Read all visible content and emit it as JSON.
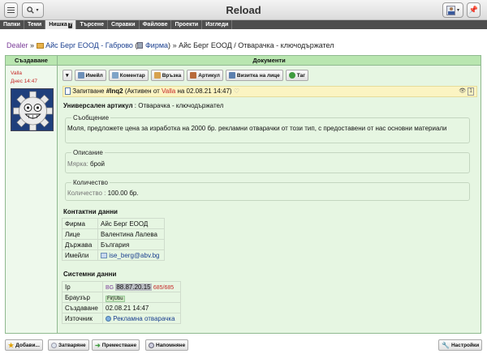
{
  "app": {
    "title": "Reload"
  },
  "nav": [
    {
      "label": "Папки"
    },
    {
      "label": "Теми"
    },
    {
      "label": "Нишка",
      "badge": "?"
    },
    {
      "label": "Търсене"
    },
    {
      "label": "Справки"
    },
    {
      "label": "Файлове"
    },
    {
      "label": "Проекти"
    },
    {
      "label": "Изгледи"
    }
  ],
  "breadcrumb": {
    "root": "Dealer",
    "sep": "»",
    "company": "Айс Берг ЕООД - Габрово",
    "open_paren": "(",
    "type": "Фирма",
    "close_paren": ")",
    "current": "Айс Берг ЕООД / Отварачка - ключодържател"
  },
  "columns": {
    "left": "Създаване",
    "right": "Документи"
  },
  "author": {
    "name": "Valla",
    "when": "Днес 14:47"
  },
  "toolbar": {
    "buttons": [
      {
        "label": "Имейл",
        "icon": "email-icon",
        "color": "#6d8fb8"
      },
      {
        "label": "Коментар",
        "icon": "comment-icon",
        "color": "#7ea3c7"
      },
      {
        "label": "Връзка",
        "icon": "link-icon",
        "color": "#d7a24f"
      },
      {
        "label": "Артикул",
        "icon": "article-icon",
        "color": "#b86a3a"
      },
      {
        "label": "Визитка на лице",
        "icon": "vcard-icon",
        "color": "#5b7fae"
      },
      {
        "label": "Таг",
        "icon": "tag-icon",
        "color": "#3f9b3f"
      }
    ]
  },
  "request": {
    "label": "Запитване",
    "id": "#Inq2",
    "status_open": "(Активен от",
    "user": "Valla",
    "status_close": "на 02.08.21 14:47)",
    "views": "1"
  },
  "article": {
    "label": "Универсален артикул",
    "value": ": Отварачка - ключодържател"
  },
  "message": {
    "legend": "Съобщение",
    "text": "Моля, предложете цена за изработка на 2000 бр. рекламни отварачки от този тип, с предоставени от нас основни материали"
  },
  "description": {
    "legend": "Описание",
    "unit_label": "Мярка:",
    "unit_value": "брой"
  },
  "quantity": {
    "legend": "Количество",
    "label": "Количество :",
    "value": "100.00 бр."
  },
  "contact": {
    "heading": "Контактни данни",
    "rows": [
      {
        "key": "Фирма",
        "value": "Айс Берг ЕООД"
      },
      {
        "key": "Лице",
        "value": "Валентина Лалева"
      },
      {
        "key": "Държава",
        "value": "България"
      },
      {
        "key": "Имейли",
        "value": "ise_berg@abv.bg"
      }
    ]
  },
  "system": {
    "heading": "Системни данни",
    "ip_label": "Ip",
    "ip_country": "BG",
    "ip": "88.87.20.15",
    "ip_count": "685/685",
    "browser_label": "Браузър",
    "browser": "Fir|Ubu",
    "created_label": "Създаване",
    "created": "02.08.21 14:47",
    "source_label": "Източник",
    "source": "Рекламна отварачка"
  },
  "bottom": {
    "add": "Добави...",
    "close": "Затваряне",
    "move": "Преместване",
    "remind": "Напомняне",
    "settings": "Настройки"
  }
}
